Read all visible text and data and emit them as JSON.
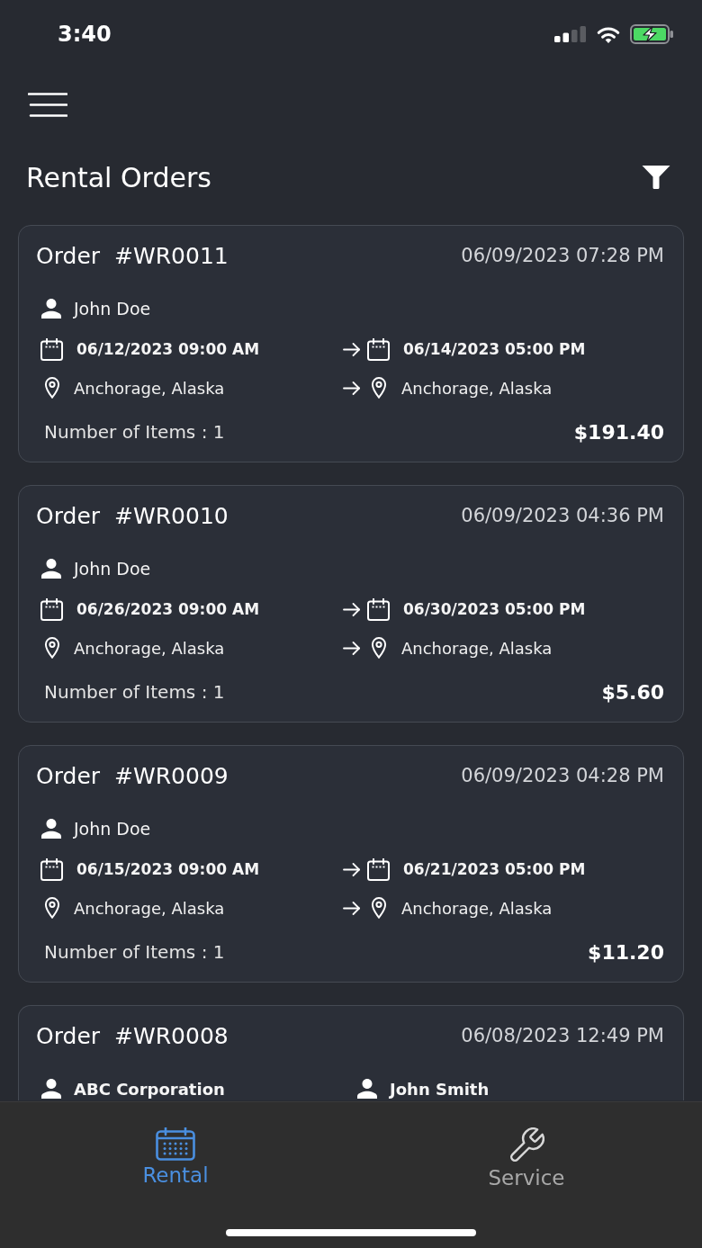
{
  "status_bar": {
    "time": "3:40"
  },
  "header": {
    "title": "Rental Orders"
  },
  "orders": [
    {
      "label": "Order",
      "number": "#WR0011",
      "created": "06/09/2023 07:28 PM",
      "customers": [
        {
          "name": "John Doe",
          "kind": "individual"
        }
      ],
      "start": "06/12/2023 09:00 AM",
      "end": "06/14/2023 05:00 PM",
      "pickup": "Anchorage, Alaska",
      "dropoff": "Anchorage, Alaska",
      "items": "Number of Items : 1",
      "total": "$191.40"
    },
    {
      "label": "Order",
      "number": "#WR0010",
      "created": "06/09/2023 04:36 PM",
      "customers": [
        {
          "name": "John Doe",
          "kind": "individual"
        }
      ],
      "start": "06/26/2023 09:00 AM",
      "end": "06/30/2023 05:00 PM",
      "pickup": "Anchorage, Alaska",
      "dropoff": "Anchorage, Alaska",
      "items": "Number of Items : 1",
      "total": "$5.60"
    },
    {
      "label": "Order",
      "number": "#WR0009",
      "created": "06/09/2023 04:28 PM",
      "customers": [
        {
          "name": "John Doe",
          "kind": "individual"
        }
      ],
      "start": "06/15/2023 09:00 AM",
      "end": "06/21/2023 05:00 PM",
      "pickup": "Anchorage, Alaska",
      "dropoff": "Anchorage, Alaska",
      "items": "Number of Items : 1",
      "total": "$11.20"
    },
    {
      "label": "Order",
      "number": "#WR0008",
      "created": "06/08/2023 12:49 PM",
      "customers": [
        {
          "name": "ABC Corporation",
          "kind": "company"
        },
        {
          "name": "John Smith",
          "kind": "contact"
        }
      ]
    }
  ],
  "tab_bar": {
    "tabs": [
      {
        "label": "Rental",
        "selected": true
      },
      {
        "label": "Service",
        "selected": false
      }
    ]
  }
}
